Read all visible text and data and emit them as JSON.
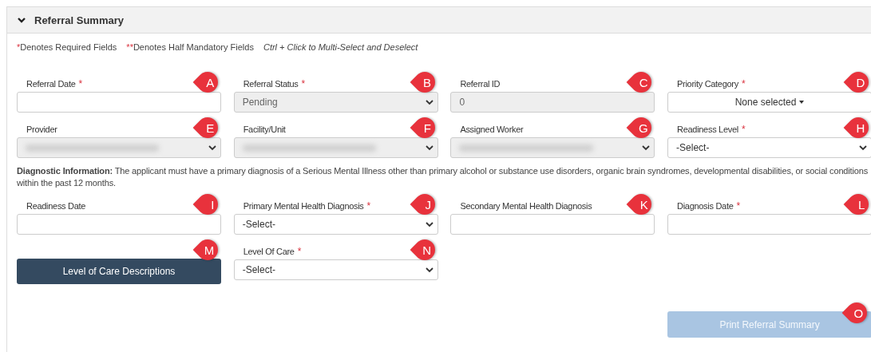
{
  "section": {
    "title": "Referral Summary",
    "expanded": true
  },
  "legend": [
    {
      "mark": "*",
      "text": "Denotes Required Fields"
    },
    {
      "mark": "**",
      "text": "Denotes Half Mandatory Fields"
    }
  ],
  "hint": "Ctrl + Click to Multi-Select and Deselect",
  "rows_top": [
    [
      {
        "kind": "input",
        "label": "Referral Date",
        "mark": "*",
        "disabled": false,
        "marker": "A"
      },
      {
        "kind": "select",
        "label": "Referral Status",
        "mark": "*",
        "value": "Pending",
        "disabled": true,
        "marker": "B"
      },
      {
        "kind": "input",
        "label": "Referral ID",
        "value": "0",
        "disabled": true,
        "marker": "C"
      },
      {
        "kind": "multiselect",
        "label": "Priority Category",
        "mark": "*",
        "value": "None selected",
        "disabled": false,
        "marker": "D"
      }
    ],
    [
      {
        "kind": "select",
        "label": "Provider",
        "disabled": true,
        "redacted": true,
        "marker": "E"
      },
      {
        "kind": "select",
        "label": "Facility/Unit",
        "disabled": true,
        "redacted": true,
        "marker": "F"
      },
      {
        "kind": "select",
        "label": "Assigned Worker",
        "disabled": true,
        "redacted": true,
        "marker": "G"
      },
      {
        "kind": "select",
        "label": "Readiness Level",
        "mark": "*",
        "value": "-Select-",
        "disabled": false,
        "marker": "H"
      }
    ]
  ],
  "diagnostic_info": "**Diagnostic Information:** The applicant must have a primary diagnosis of a Serious Mental Illness other than primary alcohol or substance use disorders, organic brain syndromes, developmental disabilities, or social conditions within the past 12 months.",
  "rows_bottom": [
    [
      {
        "kind": "input",
        "label": "Readiness Date",
        "disabled": false,
        "marker": "I"
      },
      {
        "kind": "select",
        "label": "Primary Mental Health Diagnosis",
        "mark": "*",
        "value": "-Select-",
        "disabled": false,
        "marker": "J"
      },
      {
        "kind": "input",
        "label": "Secondary Mental Health Diagnosis",
        "disabled": false,
        "marker": "K"
      },
      {
        "kind": "input",
        "label": "Diagnosis Date",
        "mark": "*",
        "disabled": false,
        "marker": "L"
      }
    ],
    [
      {
        "kind": "button",
        "text": "Level of Care Descriptions",
        "disabled": false,
        "marker": "M"
      },
      {
        "kind": "select",
        "label": "Level Of Care",
        "mark": "*",
        "value": "-Select-",
        "disabled": false,
        "marker": "N"
      }
    ]
  ],
  "print_button": {
    "text": "Print Referral Summary",
    "disabled": true,
    "marker": "O"
  }
}
